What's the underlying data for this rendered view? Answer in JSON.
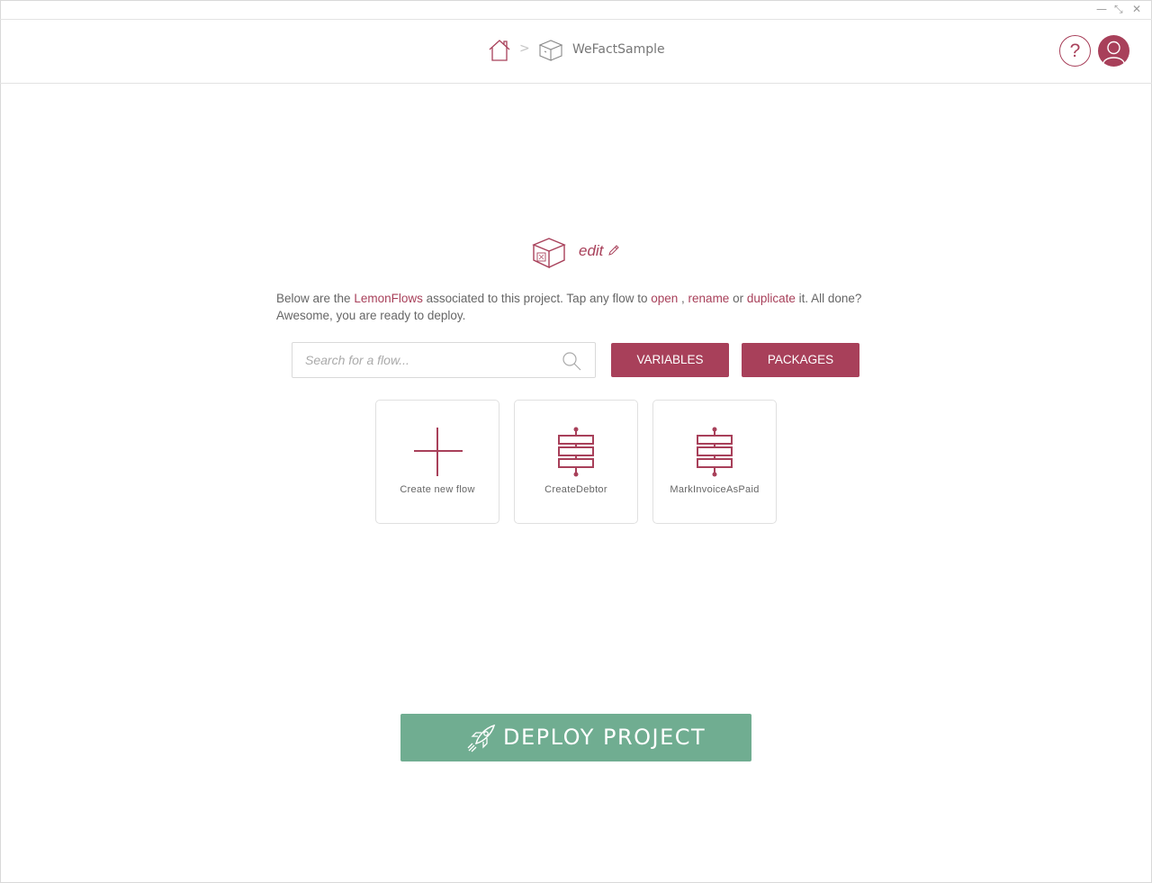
{
  "window": {
    "minimize_glyph": "—",
    "restore_glyph": "⤡",
    "close_glyph": "✕"
  },
  "header": {
    "breadcrumb": {
      "home_icon": "home-icon",
      "separator": ">",
      "project_icon": "box-icon",
      "project_name": "WeFactSample"
    },
    "help_label": "?",
    "user_icon": "user-icon"
  },
  "project": {
    "edit_label": "edit",
    "edit_icon": "pencil-icon",
    "description": {
      "part1": "Below are the ",
      "link_lemonflows": "LemonFlows",
      "part2": " associated to this project. Tap any flow to ",
      "link_open": "open",
      "part3": " , ",
      "link_rename": "rename",
      "part4": " or ",
      "link_duplicate": "duplicate",
      "part5": " it. All done? Awesome, you are ready to deploy."
    }
  },
  "toolbar": {
    "search_placeholder": "Search for a flow...",
    "search_value": "",
    "variables_label": "VARIABLES",
    "packages_label": "PACKAGES"
  },
  "flows": [
    {
      "label": "Create new flow",
      "icon": "plus-icon"
    },
    {
      "label": "CreateDebtor",
      "icon": "flow-icon"
    },
    {
      "label": "MarkInvoiceAsPaid",
      "icon": "flow-icon"
    }
  ],
  "deploy": {
    "label": "DEPLOY PROJECT",
    "icon": "rocket-icon"
  },
  "colors": {
    "accent": "#a8405a",
    "deploy": "#70ad91"
  }
}
